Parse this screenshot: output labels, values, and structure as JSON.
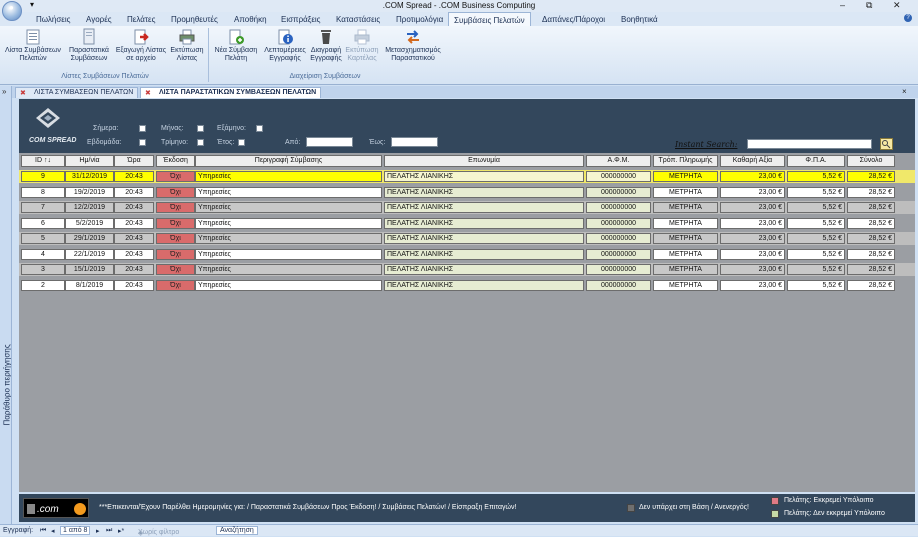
{
  "window": {
    "title": ".COM Spread - .COM Business Computing",
    "quick_access": "▾",
    "minimize": "–",
    "restore": "⧉",
    "close": "✕"
  },
  "menu_tabs": [
    "Πωλήσεις",
    "Αγορές",
    "Πελάτες",
    "Προμηθευτές",
    "Αποθήκη",
    "Εισπράξεις",
    "Καταστάσεις",
    "Προτιμολόγια",
    "Συμβάσεις Πελατών",
    "Δαπάνες/Πάροχοι",
    "Βοηθητικά"
  ],
  "ribbon": {
    "buttons": [
      {
        "l1": "Λίστα Συμβάσεων",
        "l2": "Πελατών"
      },
      {
        "l1": "Παραστατικά",
        "l2": "Συμβάσεων"
      },
      {
        "l1": "Εξαγωγή Λίστας",
        "l2": "σε αρχείο"
      },
      {
        "l1": "Εκτύπωση",
        "l2": "Λίστας"
      },
      {
        "l1": "Νέα Σύμβαση",
        "l2": "Πελάτη"
      },
      {
        "l1": "Λεπτομέρειες",
        "l2": "Εγγραφής"
      },
      {
        "l1": "Διαγραφή",
        "l2": "Εγγραφής"
      },
      {
        "l1": "Εκτύπωση",
        "l2": "Καρτέλας"
      },
      {
        "l1": "Μετασχηματισμός",
        "l2": "Παραστατικού"
      }
    ],
    "group1": "Λίστες Συμβάσεων Πελατών",
    "group2": "Διαχείριση Συμβάσεων"
  },
  "doc_tabs": [
    "ΛΙΣΤΑ ΣΥΜΒΑΣΕΩΝ ΠΕΛΑΤΩΝ",
    "ΛΙΣΤΑ ΠΑΡΑΣΤΑΤΙΚΩΝ ΣΥΜΒΑΣΕΩΝ ΠΕΛΑΤΩΝ"
  ],
  "nav_pane": {
    "label": "Παράθυρο περιήγησης",
    "collapse": "»"
  },
  "logo_text": "COM SPREAD",
  "filters": {
    "today": "Σήμερα:",
    "week": "Εβδομάδα:",
    "month": "Μήνας:",
    "quarter": "Τρίμηνο:",
    "semester": "Εξάμηνο:",
    "year": "Έτος:",
    "from": "Από:",
    "to": "Έως:"
  },
  "instant_search": "Instant Search:",
  "columns": [
    "ID ↑↓",
    "Ημ/νία",
    "Ώρα",
    "Έκδοση",
    "Περιγραφή Σύμβασης",
    "Επωνυμία",
    "Α.Φ.Μ.",
    "Τρόπ. Πληρωμής",
    "Καθαρή Αξία",
    "Φ.Π.Α.",
    "Σύνολο"
  ],
  "rows": [
    {
      "id": "9",
      "date": "31/12/2019",
      "time": "20:43",
      "issued": "Όχι",
      "desc": "Υπηρεσίες",
      "name": "ΠΕΛΑΤΗΣ ΛΙΑΝΙΚΗΣ",
      "afm": "000000000",
      "pay": "ΜΕΤΡΗΤΑ",
      "net": "23,00 €",
      "vat": "5,52 €",
      "total": "28,52 €"
    },
    {
      "id": "8",
      "date": "19/2/2019",
      "time": "20:43",
      "issued": "Όχι",
      "desc": "Υπηρεσίες",
      "name": "ΠΕΛΑΤΗΣ ΛΙΑΝΙΚΗΣ",
      "afm": "000000000",
      "pay": "ΜΕΤΡΗΤΑ",
      "net": "23,00 €",
      "vat": "5,52 €",
      "total": "28,52 €"
    },
    {
      "id": "7",
      "date": "12/2/2019",
      "time": "20:43",
      "issued": "Όχι",
      "desc": "Υπηρεσίες",
      "name": "ΠΕΛΑΤΗΣ ΛΙΑΝΙΚΗΣ",
      "afm": "000000000",
      "pay": "ΜΕΤΡΗΤΑ",
      "net": "23,00 €",
      "vat": "5,52 €",
      "total": "28,52 €"
    },
    {
      "id": "6",
      "date": "5/2/2019",
      "time": "20:43",
      "issued": "Όχι",
      "desc": "Υπηρεσίες",
      "name": "ΠΕΛΑΤΗΣ ΛΙΑΝΙΚΗΣ",
      "afm": "000000000",
      "pay": "ΜΕΤΡΗΤΑ",
      "net": "23,00 €",
      "vat": "5,52 €",
      "total": "28,52 €"
    },
    {
      "id": "5",
      "date": "29/1/2019",
      "time": "20:43",
      "issued": "Όχι",
      "desc": "Υπηρεσίες",
      "name": "ΠΕΛΑΤΗΣ ΛΙΑΝΙΚΗΣ",
      "afm": "000000000",
      "pay": "ΜΕΤΡΗΤΑ",
      "net": "23,00 €",
      "vat": "5,52 €",
      "total": "28,52 €"
    },
    {
      "id": "4",
      "date": "22/1/2019",
      "time": "20:43",
      "issued": "Όχι",
      "desc": "Υπηρεσίες",
      "name": "ΠΕΛΑΤΗΣ ΛΙΑΝΙΚΗΣ",
      "afm": "000000000",
      "pay": "ΜΕΤΡΗΤΑ",
      "net": "23,00 €",
      "vat": "5,52 €",
      "total": "28,52 €"
    },
    {
      "id": "3",
      "date": "15/1/2019",
      "time": "20:43",
      "issued": "Όχι",
      "desc": "Υπηρεσίες",
      "name": "ΠΕΛΑΤΗΣ ΛΙΑΝΙΚΗΣ",
      "afm": "000000000",
      "pay": "ΜΕΤΡΗΤΑ",
      "net": "23,00 €",
      "vat": "5,52 €",
      "total": "28,52 €"
    },
    {
      "id": "2",
      "date": "8/1/2019",
      "time": "20:43",
      "issued": "Όχι",
      "desc": "Υπηρεσίες",
      "name": "ΠΕΛΑΤΗΣ ΛΙΑΝΙΚΗΣ",
      "afm": "000000000",
      "pay": "ΜΕΤΡΗΤΑ",
      "net": "23,00 €",
      "vat": "5,52 €",
      "total": "28,52 €"
    }
  ],
  "footer": {
    "note": "***Επικεινται/Έχουν Παρέλθει Ημερομηνίες για:  / Παραστατικά Συμβάσεων Προς Έκδοση! / Συμβάσεις Πελατών! / Είσπραξη Επιταγών!",
    "legend_missing": "Δεν υπάρχει στη Βάση / Ανενεργός!",
    "legend_pending": "Πελάτης: Εκκρεμεί Υπόλοιπο",
    "legend_clear": "Πελάτης: Δεν εκκρεμεί Υπόλοιπο"
  },
  "statusbar": {
    "record": "Εγγραφή:",
    "nav_first": "⏮",
    "nav_prev": "◂",
    "position": "1 από 8",
    "nav_next": "▸",
    "nav_last": "⏭",
    "nav_new": "▸*",
    "filter": "Χωρίς φίλτρο",
    "search": "Αναζήτηση"
  },
  "colors": {
    "selected_row": "#ffff00",
    "issued_no": "#d96b6b",
    "name_cell": "#e6ecd2",
    "odd_row": "#c8c8c8",
    "footer_bg": "#33475c"
  }
}
